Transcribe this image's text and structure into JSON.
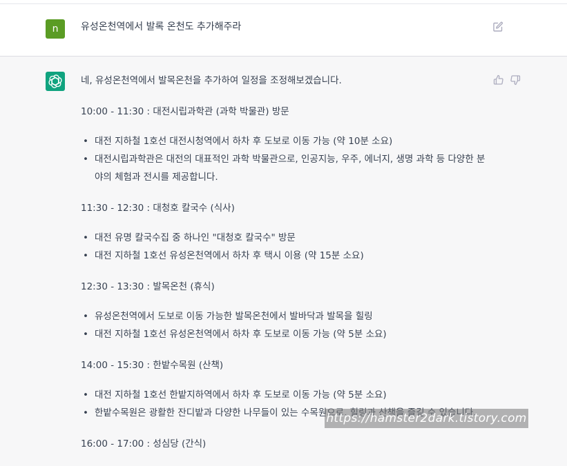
{
  "user_message": {
    "avatar_letter": "n",
    "text": "유성온천역에서 발록 온천도 추가해주라"
  },
  "assistant_message": {
    "intro": "네, 유성온천역에서 발목온천을 추가하여 일정을 조정해보겠습니다.",
    "sections": [
      {
        "heading": "10:00 - 11:30 : 대전시립과학관 (과학 박물관) 방문",
        "bullets": [
          "대전 지하철 1호선 대전시청역에서 하차 후 도보로 이동 가능 (약 10분 소요)",
          "대전시립과학관은 대전의 대표적인 과학 박물관으로, 인공지능, 우주, 에너지, 생명 과학 등 다양한 분야의 체험과 전시를 제공합니다."
        ]
      },
      {
        "heading": "11:30 - 12:30 : 대청호 칼국수 (식사)",
        "bullets": [
          "대전 유명 칼국수집 중 하나인 \"대청호 칼국수\" 방문",
          "대전 지하철 1호선 유성온천역에서 하차 후 택시 이용 (약 15분 소요)"
        ]
      },
      {
        "heading": "12:30 - 13:30 : 발목온천 (휴식)",
        "bullets": [
          "유성온천역에서 도보로 이동 가능한 발목온천에서 발바닥과 발목을 힐링",
          "대전 지하철 1호선 유성온천역에서 하차 후 도보로 이동 가능 (약 5분 소요)"
        ]
      },
      {
        "heading": "14:00 - 15:30 : 한밭수목원 (산책)",
        "bullets": [
          "대전 지하철 1호선 한밭지하역에서 하차 후 도보로 이동 가능 (약 5분 소요)",
          "한밭수목원은 광활한 잔디밭과 다양한 나무들이 있는 수목원으로, 힐링과 산책을 즐길 수 있습니다."
        ]
      },
      {
        "heading": "16:00 - 17:00 : 성심당 (간식)",
        "bullets": []
      }
    ]
  },
  "watermark": "https://hamster2dark.tistory.com",
  "colors": {
    "user_avatar": "#5a9c24",
    "assistant_avatar": "#10a37f",
    "assistant_bg": "#f7f7f8",
    "text": "#374151"
  },
  "icons": {
    "edit": "edit-icon",
    "thumbs_up": "thumbs-up-icon",
    "thumbs_down": "thumbs-down-icon",
    "logo": "openai-logo-icon"
  }
}
